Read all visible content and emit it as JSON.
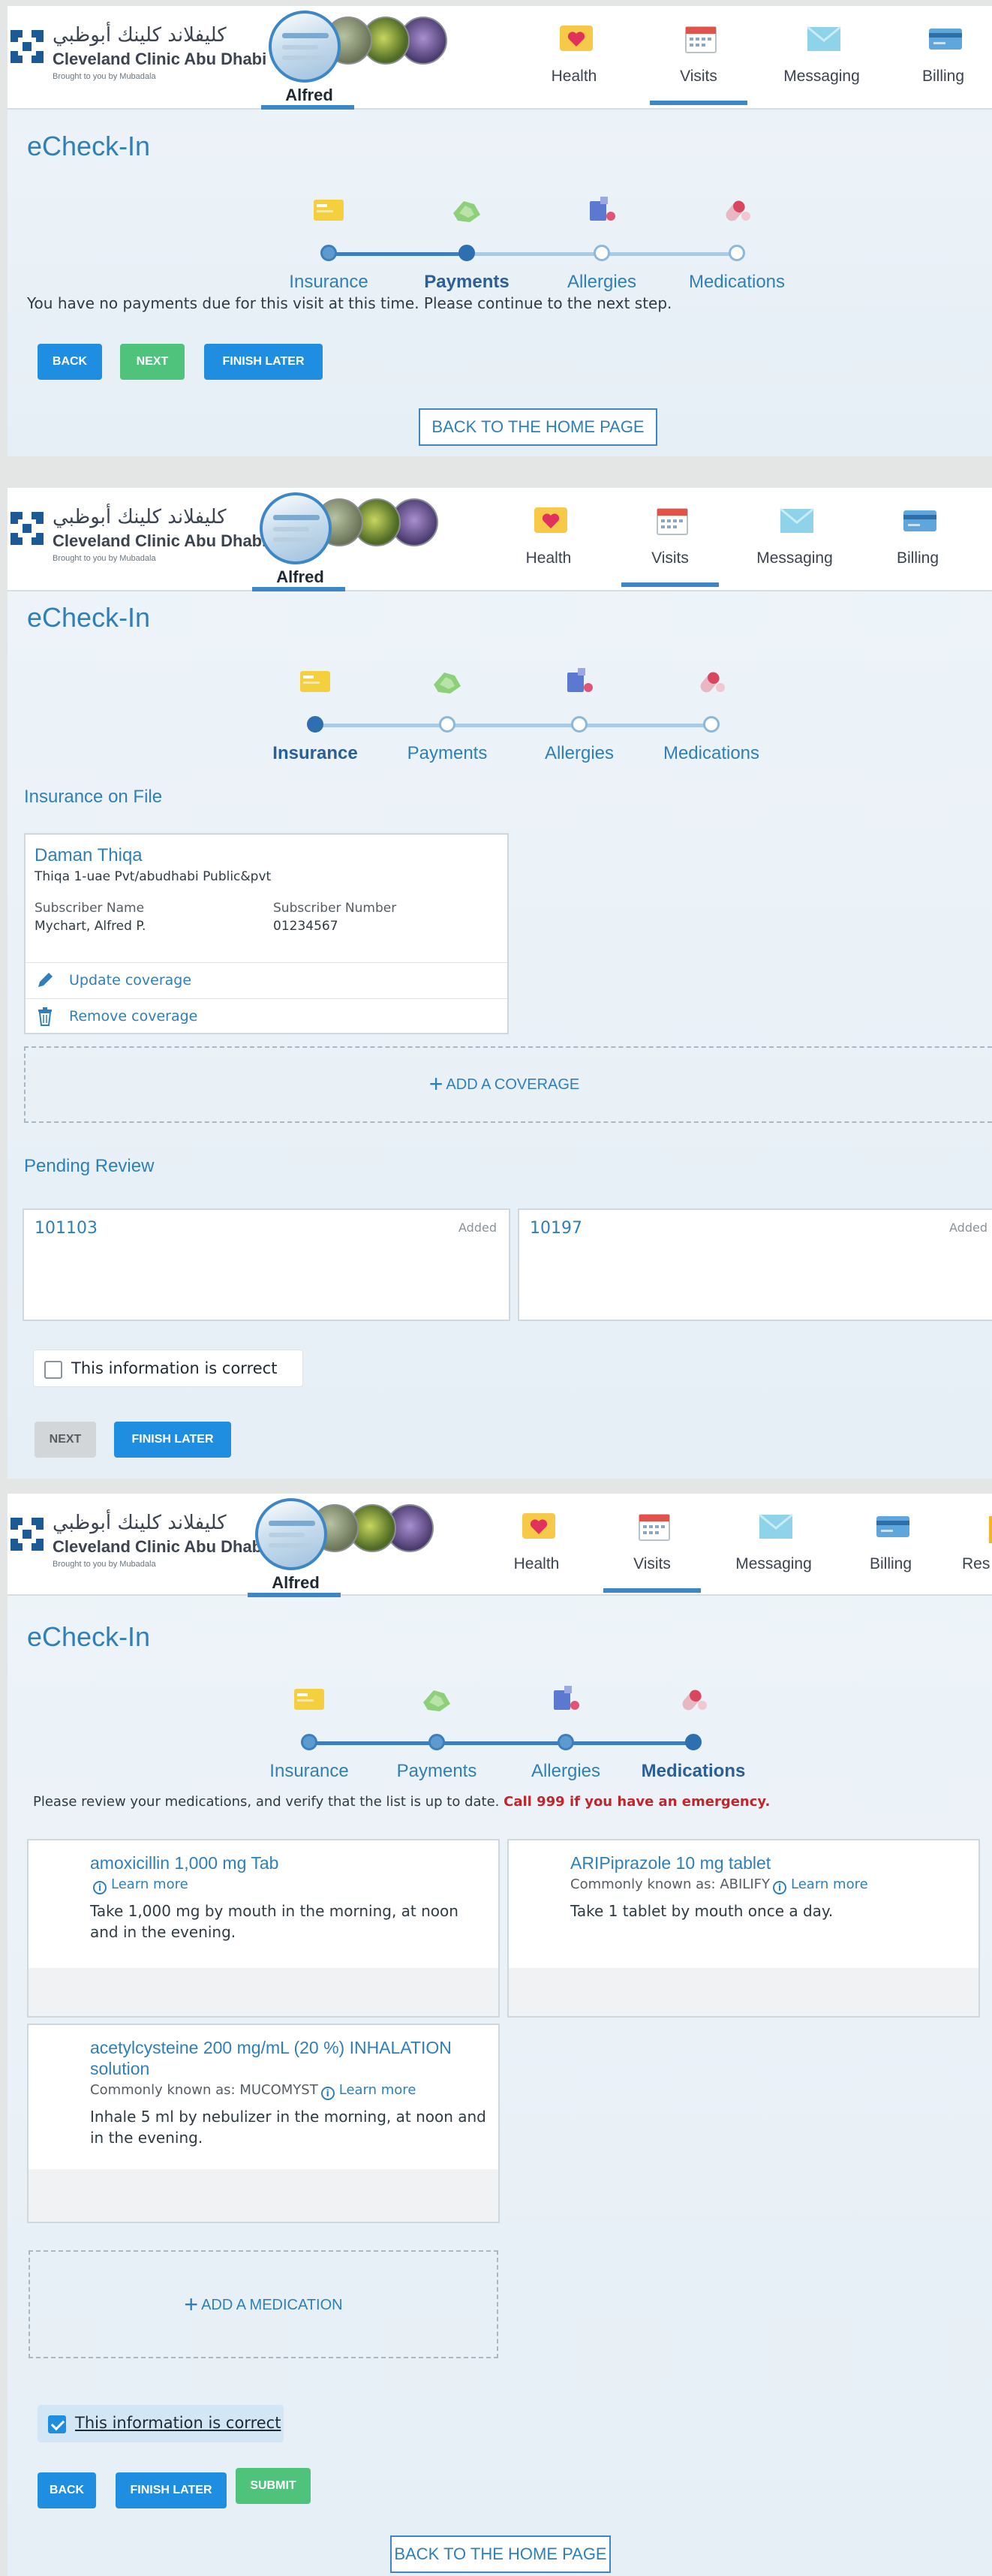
{
  "brand": {
    "arabic": "كليفلاند كلينك أبوظبي",
    "english": "Cleveland Clinic Abu Dhabi",
    "tagline": "Brought to you by Mubadala"
  },
  "profile": {
    "name": "Alfred"
  },
  "nav": {
    "health": "Health",
    "visits": "Visits",
    "messaging": "Messaging",
    "billing": "Billing",
    "resources": "Res"
  },
  "page_title": "eCheck-In",
  "steps": [
    "Insurance",
    "Payments",
    "Allergies",
    "Medications"
  ],
  "screen1": {
    "message": "You have no payments due for this visit at this time. Please continue to the next step.",
    "back": "BACK",
    "next": "NEXT",
    "finish_later": "FINISH LATER",
    "home": "BACK TO THE HOME PAGE"
  },
  "screen2": {
    "insurance_heading": "Insurance on File",
    "insurance": {
      "name": "Daman Thiqa",
      "plan": "Thiqa 1-uae Pvt/abudhabi Public&pvt",
      "subscriber_name_label": "Subscriber Name",
      "subscriber_name": "Mychart, Alfred P.",
      "subscriber_number_label": "Subscriber Number",
      "subscriber_number": "01234567",
      "update": "Update coverage",
      "remove": "Remove coverage"
    },
    "add_coverage": "ADD A COVERAGE",
    "pending_heading": "Pending Review",
    "pending": [
      {
        "id": "101103",
        "status": "Added"
      },
      {
        "id": "10197",
        "status": "Added"
      }
    ],
    "confirm": "This information is correct",
    "confirm_checked": false,
    "next": "NEXT",
    "finish_later": "FINISH LATER"
  },
  "screen3": {
    "message": "Please review your medications, and verify that the list is up to date.",
    "emergency": "Call 999 if you have an emergency.",
    "learn_more": "Learn more",
    "medications": [
      {
        "name": "amoxicillin 1,000 mg Tab",
        "aka": "",
        "sig": "Take 1,000 mg by mouth in the morning, at noon and in the evening."
      },
      {
        "name": "ARIPiprazole 10 mg tablet",
        "aka": "Commonly known as: ABILIFY",
        "sig": "Take 1 tablet by mouth once a day."
      },
      {
        "name": "acetylcysteine 200 mg/mL (20 %) INHALATION solution",
        "aka": "Commonly known as: MUCOMYST",
        "sig": "Inhale 5 ml by nebulizer in the morning, at noon and in the evening."
      }
    ],
    "add_medication": "ADD A MEDICATION",
    "confirm": "This information is correct",
    "confirm_checked": true,
    "back": "BACK",
    "finish_later": "FINISH LATER",
    "submit": "SUBMIT",
    "home": "BACK TO THE HOME PAGE"
  },
  "colors": {
    "accent": "#2f7fb9",
    "primary_button": "#1f8de0",
    "next_button": "#4fc27c",
    "emergency": "#c0272d"
  },
  "icons": [
    "insurance-card-icon",
    "payments-icon",
    "allergies-icon",
    "medications-icon",
    "heart-icon",
    "calendar-icon",
    "envelope-icon",
    "billing-icon"
  ]
}
